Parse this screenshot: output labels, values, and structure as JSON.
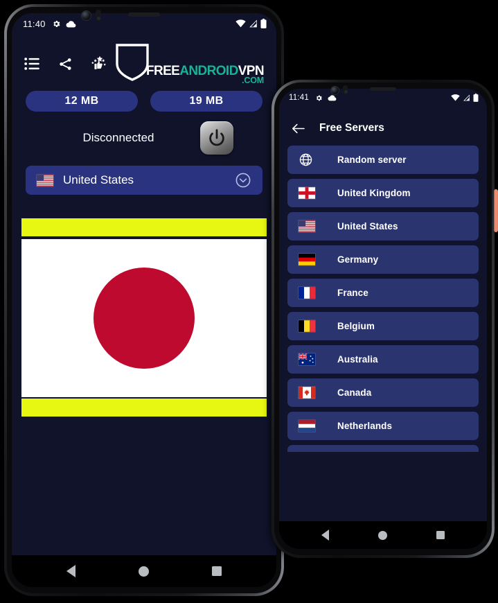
{
  "phone1": {
    "status_bar": {
      "time": "11:40",
      "left_icons": [
        "settings-gear-icon",
        "cloud-icon"
      ],
      "right_icons": [
        "wifi-icon",
        "cellular-signal-icon",
        "battery-icon"
      ]
    },
    "toolbar": {
      "icons": [
        {
          "name": "list-menu-icon",
          "label": "Servers list"
        },
        {
          "name": "share-icon",
          "label": "Share"
        },
        {
          "name": "rate-us-icon",
          "label": "Rate us"
        }
      ],
      "brand": {
        "free": "FREE",
        "android": "ANDROID",
        "vpn": "VPN",
        "com": ".COM",
        "accent_color": "#17b398",
        "white_color": "#ffffff"
      }
    },
    "stats": {
      "download_label": "12 MB",
      "upload_label": "19 MB",
      "pill_color": "#2a3380"
    },
    "connection": {
      "status": "Disconnected",
      "power_button": "power-button"
    },
    "country_select": {
      "flag": "🇺🇸",
      "name": "United States",
      "chevron": "chevron-down-circle-icon"
    },
    "ad_area": {
      "top_bar_color": "#e8f711",
      "bottom_bar_color": "#e8f711",
      "flag_name": "Japan flag",
      "flag_bg": "#ffffff",
      "flag_disc_color": "#bf0a30"
    },
    "navbar": [
      "back-nav-icon",
      "home-nav-icon",
      "recents-nav-icon"
    ]
  },
  "phone2": {
    "status_bar": {
      "time": "11:41",
      "left_icons": [
        "settings-gear-icon",
        "cloud-icon"
      ],
      "right_icons": [
        "wifi-icon",
        "cellular-signal-icon",
        "battery-icon"
      ]
    },
    "header": {
      "back": "back-arrow-icon",
      "title": "Free Servers"
    },
    "servers": [
      {
        "name": "Random server",
        "flag": "globe"
      },
      {
        "name": "United Kingdom",
        "flag": "england"
      },
      {
        "name": "United States",
        "flag": "usa"
      },
      {
        "name": "Germany",
        "flag": "germany"
      },
      {
        "name": "France",
        "flag": "france"
      },
      {
        "name": "Belgium",
        "flag": "belgium"
      },
      {
        "name": "Australia",
        "flag": "australia"
      },
      {
        "name": "Canada",
        "flag": "canada"
      },
      {
        "name": "Netherlands",
        "flag": "netherlands"
      }
    ],
    "row_color": "#2a3570",
    "navbar": [
      "back-nav-icon",
      "home-nav-icon",
      "recents-nav-icon"
    ]
  },
  "theme": {
    "screen_bg": "#10132a",
    "accent_blue": "#2a3380",
    "brand_teal": "#17b398",
    "ad_yellow": "#e8f711",
    "side_button": "#e8806a"
  }
}
